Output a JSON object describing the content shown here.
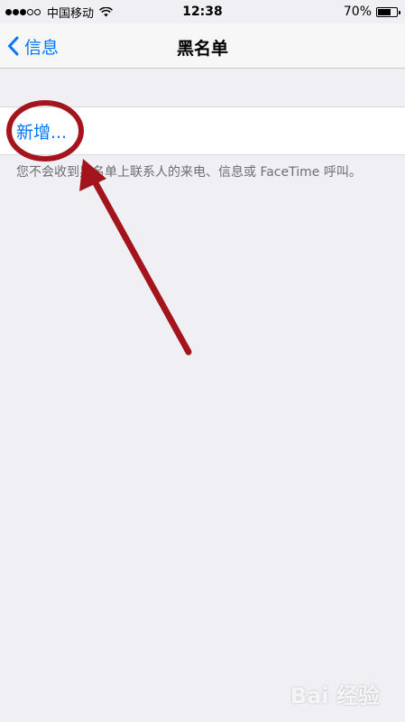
{
  "status_bar": {
    "carrier": "中国移动",
    "time": "12:38",
    "battery": "70%",
    "battery_level": 0.7,
    "signal_strength": 3,
    "signal_max": 5
  },
  "nav": {
    "back_label": "信息",
    "title": "黑名单"
  },
  "blocked_list": {
    "add_label": "新增...",
    "footer_note": "您不会收到黑名单上联系人的来电、信息或 FaceTime 呼叫。"
  },
  "watermark": {
    "text": "Bai 经验"
  },
  "colors": {
    "accent": "#0076ff",
    "background": "#efeff4",
    "annotation": "#a3141c"
  }
}
